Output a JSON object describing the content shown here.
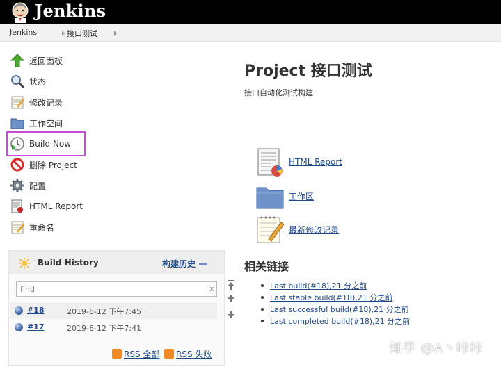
{
  "header": {
    "brand": "Jenkins",
    "logo_icon": "jenkins-butler-logo"
  },
  "breadcrumb": {
    "items": [
      "Jenkins",
      "接口测试"
    ]
  },
  "sidebar": {
    "tasks": [
      {
        "label": "返回面板",
        "icon": "up-arrow-icon"
      },
      {
        "label": "状态",
        "icon": "magnifier-icon"
      },
      {
        "label": "修改记录",
        "icon": "notepad-icon"
      },
      {
        "label": "工作空间",
        "icon": "folder-icon"
      },
      {
        "label": "Build Now",
        "icon": "clock-play-icon"
      },
      {
        "label": "删除 Project",
        "icon": "no-entry-icon"
      },
      {
        "label": "配置",
        "icon": "gear-icon"
      },
      {
        "label": "HTML Report",
        "icon": "report-icon"
      },
      {
        "label": "重命名",
        "icon": "rename-icon"
      }
    ],
    "highlight_color": "#c74bdc"
  },
  "build_history": {
    "title": "Build History",
    "trend_label": "构建历史",
    "search_placeholder": "find",
    "search_clear": "x",
    "builds": [
      {
        "number": "#18",
        "date": "2019-6-12 下午7:45"
      },
      {
        "number": "#17",
        "date": "2019-6-12 下午7:41"
      }
    ],
    "rss_all": "RSS 全部",
    "rss_failed": "RSS 失败"
  },
  "main": {
    "title": "Project 接口测试",
    "description": "接口自动化测试构建",
    "links": [
      {
        "label": "HTML Report",
        "icon": "report-chart-icon"
      },
      {
        "label": "工作区",
        "icon": "folder-icon"
      },
      {
        "label": "最新修改记录",
        "icon": "notepad-pencil-icon"
      }
    ],
    "related_title": "相关链接",
    "related_links": [
      "Last build(#18),21 分之前",
      "Last stable build(#18),21 分之前",
      "Last successful build(#18),21 分之前",
      "Last completed build(#18),21 分之前"
    ]
  },
  "watermark": "知乎 @A丶咔咔"
}
